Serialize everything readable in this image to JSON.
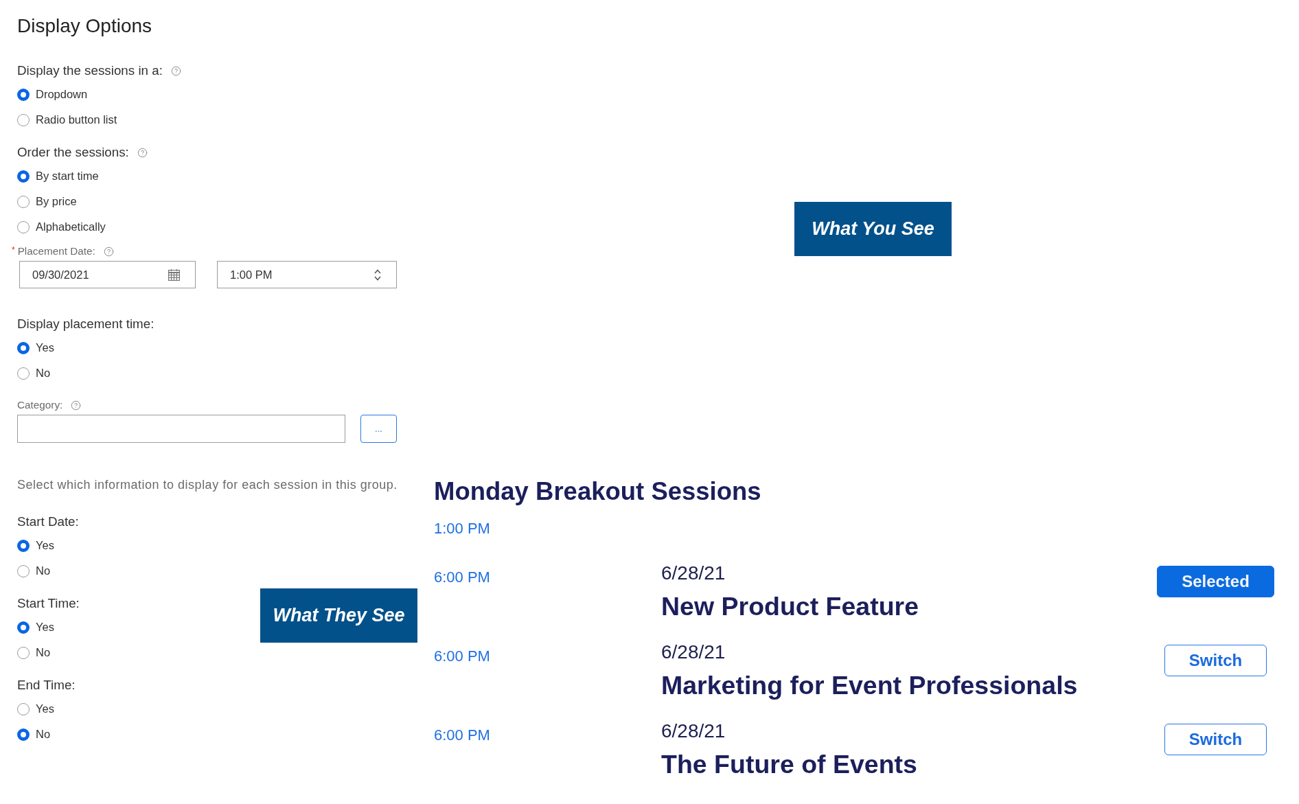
{
  "page_title": "Display Options",
  "form": {
    "groups": [
      {
        "kind": "radio",
        "label": "Display the sessions in a:",
        "help": true,
        "options": [
          {
            "label": "Dropdown",
            "selected": true
          },
          {
            "label": "Radio button list",
            "selected": false
          }
        ]
      },
      {
        "kind": "radio",
        "label": "Order the sessions:",
        "help": true,
        "options": [
          {
            "label": "By start time",
            "selected": true
          },
          {
            "label": "By price",
            "selected": false
          },
          {
            "label": "Alphabetically",
            "selected": false
          }
        ]
      },
      {
        "kind": "datetime",
        "label": "Placement Date:",
        "required_mark": "*",
        "help": true,
        "date": "09/30/2021",
        "time": "1:00 PM"
      },
      {
        "kind": "radio",
        "label": "Display placement time:",
        "help": false,
        "options": [
          {
            "label": "Yes",
            "selected": true
          },
          {
            "label": "No",
            "selected": false
          }
        ]
      },
      {
        "kind": "picker",
        "label": "Category:",
        "help": true,
        "button": "..."
      }
    ],
    "info_text": "Select which information to display for each session in this group.",
    "session_fields": [
      {
        "label": "Start Date:",
        "options": [
          {
            "label": "Yes",
            "selected": true
          },
          {
            "label": "No",
            "selected": false
          }
        ]
      },
      {
        "label": "Start Time:",
        "options": [
          {
            "label": "Yes",
            "selected": true
          },
          {
            "label": "No",
            "selected": false
          }
        ]
      },
      {
        "label": "End Time:",
        "options": [
          {
            "label": "Yes",
            "selected": false
          },
          {
            "label": "No",
            "selected": true
          }
        ]
      }
    ]
  },
  "callouts": [
    "What You See",
    "What They See"
  ],
  "preview": {
    "heading": "Monday Breakout Sessions",
    "placement_time": "1:00 PM",
    "sessions": [
      {
        "time": "6:00 PM",
        "date": "6/28/21",
        "title": "New Product Feature",
        "button": {
          "label": "Selected",
          "selected": true
        }
      },
      {
        "time": "6:00 PM",
        "date": "6/28/21",
        "title": "Marketing for Event Professionals",
        "button": {
          "label": "Switch",
          "selected": false
        }
      },
      {
        "time": "6:00 PM",
        "date": "6/28/21",
        "title": "The Future of Events",
        "button": {
          "label": "Switch",
          "selected": false
        }
      }
    ]
  }
}
